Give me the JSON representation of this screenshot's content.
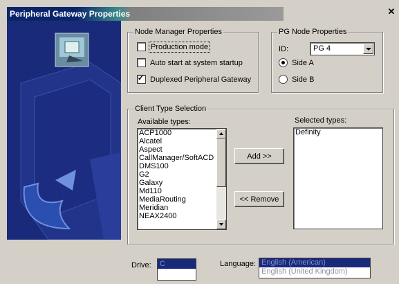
{
  "window": {
    "title": "Peripheral Gateway Properties"
  },
  "node_manager": {
    "group_label": "Node Manager Properties",
    "production_mode": {
      "label": "Production mode",
      "checked": false
    },
    "auto_start": {
      "label": "Auto start at system startup",
      "checked": false
    },
    "duplexed": {
      "label": "Duplexed Peripheral Gateway",
      "checked": true
    }
  },
  "pg_node": {
    "group_label": "PG Node Properties",
    "id_label": "ID:",
    "id_value": "PG 4",
    "side_a": {
      "label": "Side A",
      "selected": true
    },
    "side_b": {
      "label": "Side B",
      "selected": false
    }
  },
  "client_type": {
    "group_label": "Client Type Selection",
    "available_label": "Available types:",
    "available": [
      "ACP1000",
      "Alcatel",
      "Aspect",
      "CallManager/SoftACD",
      "DMS100",
      "G2",
      "Galaxy",
      "Md110",
      "MediaRouting",
      "Meridian",
      "NEAX2400"
    ],
    "selected_label": "Selected types:",
    "selected": [
      "Definity"
    ],
    "add_label": "Add >>",
    "remove_label": "<< Remove"
  },
  "bottom": {
    "drive_label": "Drive:",
    "drive_value": "C",
    "language_label": "Language:",
    "language_selected": "English (American)",
    "language_other": "English (United Kingdom)"
  },
  "colors": {
    "title_active": "#0a246a",
    "panel_blue": "#1a2a7a",
    "face": "#d4d0c8"
  }
}
